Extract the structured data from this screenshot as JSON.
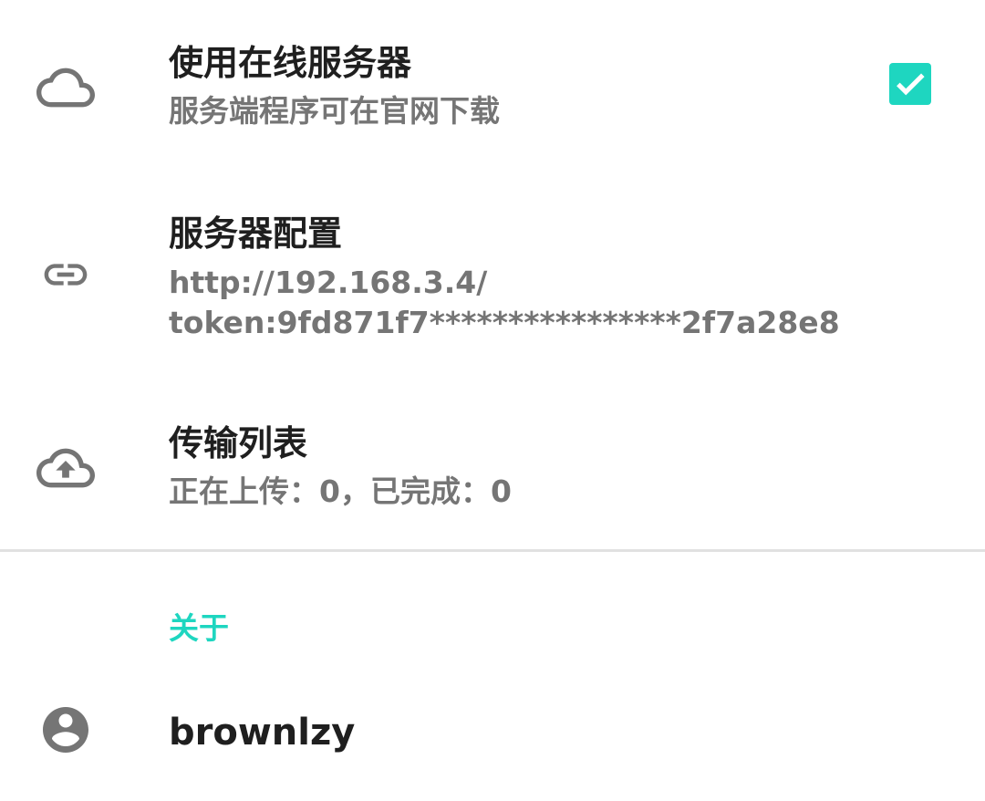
{
  "colors": {
    "accent": "#1ed6c0",
    "title_text": "#1f1f1f",
    "summary_text": "#757575",
    "icon": "#757575",
    "divider": "#e1e1e1"
  },
  "settings": {
    "online_server": {
      "icon": "cloud-icon",
      "title": "使用在线服务器",
      "summary": "服务端程序可在官网下载",
      "checked": true
    },
    "server_config": {
      "icon": "link-icon",
      "title": "服务器配置",
      "summary_line1": "http://192.168.3.4/",
      "summary_line2": "token:9fd871f7****************2f7a28e8"
    },
    "transfer_list": {
      "icon": "cloud-upload-icon",
      "title": "传输列表",
      "summary": "正在上传：0，已完成：0"
    }
  },
  "about": {
    "category_title": "关于",
    "account": {
      "icon": "account-circle-icon",
      "username": "brownlzy"
    }
  }
}
